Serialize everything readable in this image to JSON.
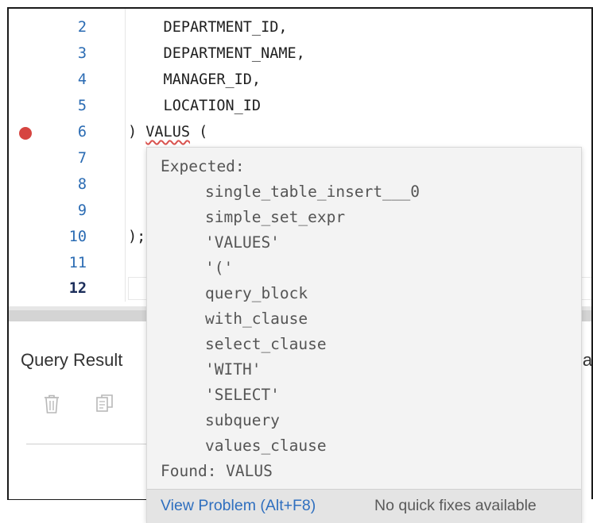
{
  "editor": {
    "lines": [
      {
        "number": "2",
        "code": "    DEPARTMENT_ID,"
      },
      {
        "number": "3",
        "code": "    DEPARTMENT_NAME,"
      },
      {
        "number": "4",
        "code": "    MANAGER_ID,"
      },
      {
        "number": "5",
        "code": "    LOCATION_ID"
      },
      {
        "number": "6",
        "code_prefix": ") ",
        "code_error": "VALUS",
        "code_suffix": " (",
        "has_breakpoint": true
      },
      {
        "number": "7",
        "code": ""
      },
      {
        "number": "8",
        "code": ""
      },
      {
        "number": "9",
        "code": ""
      },
      {
        "number": "10",
        "code": ");"
      },
      {
        "number": "11",
        "code": ""
      },
      {
        "number": "12",
        "code": "",
        "current": true
      }
    ]
  },
  "results_panel": {
    "title": "Query Result",
    "right_tab_fragment": "la",
    "toolbar": {
      "delete_icon": "trash-icon",
      "copy_icon": "copy-icon"
    }
  },
  "error_popup": {
    "expected_label": "Expected:",
    "expected_items": [
      "single_table_insert___0",
      "simple_set_expr",
      "'VALUES'",
      "'('",
      "query_block",
      "with_clause",
      "select_clause",
      "'WITH'",
      "'SELECT'",
      "subquery",
      "values_clause"
    ],
    "found_label": "Found: VALUS",
    "footer": {
      "view_problem": "View Problem (Alt+F8)",
      "no_fixes": "No quick fixes available"
    }
  },
  "colors": {
    "line_number": "#2a6bb3",
    "breakpoint": "#d64541",
    "link": "#2f6fbf",
    "error_underline": "#d9534f"
  }
}
